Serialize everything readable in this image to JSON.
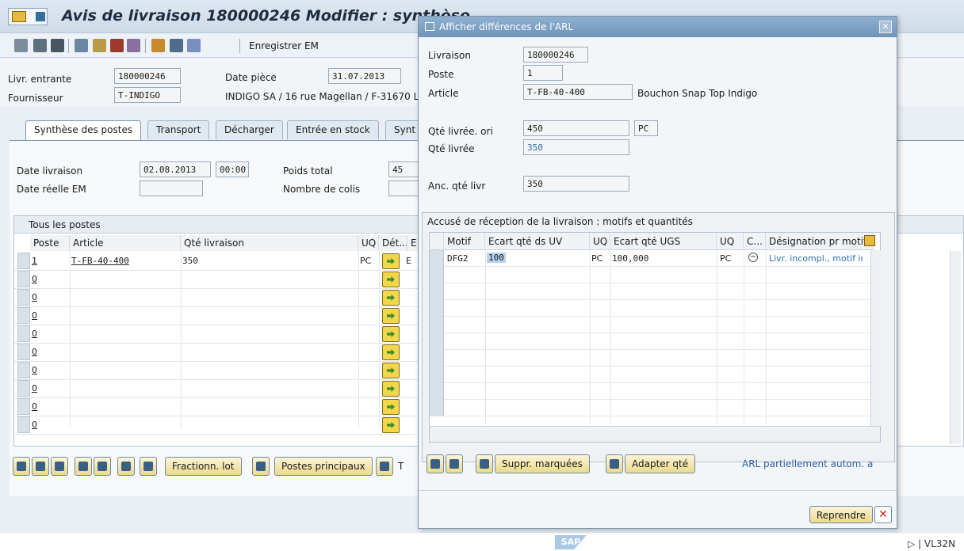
{
  "main": {
    "title": "Avis de livraison 180000246 Modifier : synthèse",
    "toolbar": {
      "save_em_label": "Enregistrer EM"
    },
    "header": {
      "livr_entrante_label": "Livr. entrante",
      "livr_entrante_value": "180000246",
      "date_piece_label": "Date pièce",
      "date_piece_value": "31.07.2013",
      "fournisseur_label": "Fournisseur",
      "fournisseur_value": "T-INDIGO",
      "fournisseur_address": "INDIGO SA / 16 rue Magellan / F-31670 L"
    },
    "tabs": [
      {
        "label": "Synthèse des postes"
      },
      {
        "label": "Transport"
      },
      {
        "label": "Décharger"
      },
      {
        "label": "Entrée en stock"
      },
      {
        "label": "Synt"
      }
    ],
    "tab_content": {
      "date_livraison_label": "Date livraison",
      "date_livraison_value": "02.08.2013",
      "heure_value": "00:00",
      "poids_total_label": "Poids total",
      "poids_total_value": "45",
      "date_reelle_label": "Date réelle EM",
      "nombre_colis_label": "Nombre de colis"
    },
    "table": {
      "caption": "Tous les postes",
      "headers": [
        "Poste",
        "Article",
        "Qté livraison",
        "UQ",
        "Dét...",
        "E"
      ],
      "rows": [
        {
          "poste": "1",
          "article": "T-FB-40-400",
          "qte": "350",
          "uq": "PC",
          "extra": "E"
        },
        {
          "poste": "0"
        },
        {
          "poste": "0"
        },
        {
          "poste": "0"
        },
        {
          "poste": "0"
        },
        {
          "poste": "0"
        },
        {
          "poste": "0"
        },
        {
          "poste": "0"
        },
        {
          "poste": "0"
        },
        {
          "poste": "0"
        }
      ]
    },
    "buttons": {
      "fractionn_lot": "Fractionn. lot",
      "postes_principaux": "Postes principaux",
      "truncated": "T"
    },
    "status": {
      "transaction": "VL32N"
    }
  },
  "dialog": {
    "title": "Afficher différences de l'ARL",
    "fields": {
      "livraison_label": "Livraison",
      "livraison_value": "180000246",
      "poste_label": "Poste",
      "poste_value": "1",
      "article_label": "Article",
      "article_value": "T-FB-40-400",
      "article_desc": "Bouchon Snap Top Indigo",
      "qte_livree_ori_label": "Qté livrée. ori",
      "qte_livree_ori_value": "450",
      "qte_livree_ori_unit": "PC",
      "qte_livree_label": "Qté livrée",
      "qte_livree_value": "350",
      "anc_qte_livr_label": "Anc. qté livr",
      "anc_qte_livr_value": "350"
    },
    "arl": {
      "caption": "Accusé de réception de la livraison : motifs et quantités",
      "headers": [
        "Motif",
        "Ecart qté ds UV",
        "UQ",
        "Ecart qté UGS",
        "UQ",
        "C...",
        "Désignation pr motif"
      ],
      "rows": [
        {
          "motif": "DFG2",
          "ecart_uv": "100",
          "uq1": "PC",
          "ecart_ugs": "100,000",
          "uq2": "PC",
          "designation": "Livr. incompl., motif in"
        }
      ]
    },
    "buttons": {
      "suppr_marquees": "Suppr. marquées",
      "adapter_qte": "Adapter qté",
      "arl_status": "ARL partiellement autom. a",
      "reprendre": "Reprendre"
    }
  }
}
